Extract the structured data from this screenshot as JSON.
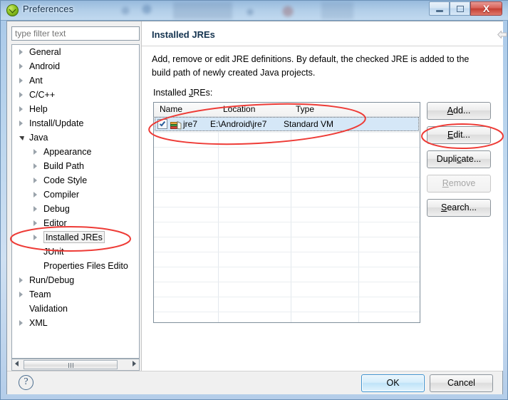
{
  "window": {
    "title": "Preferences",
    "icon": "eclipse-preferences-icon",
    "controls": {
      "minimize": "–",
      "maximize": "□",
      "close": "X"
    }
  },
  "sidebar": {
    "filter": {
      "placeholder": "type filter text",
      "value": ""
    },
    "items": [
      {
        "label": "General",
        "indent": 0,
        "state": "closed"
      },
      {
        "label": "Android",
        "indent": 0,
        "state": "closed"
      },
      {
        "label": "Ant",
        "indent": 0,
        "state": "closed"
      },
      {
        "label": "C/C++",
        "indent": 0,
        "state": "closed"
      },
      {
        "label": "Help",
        "indent": 0,
        "state": "closed"
      },
      {
        "label": "Install/Update",
        "indent": 0,
        "state": "closed"
      },
      {
        "label": "Java",
        "indent": 0,
        "state": "open"
      },
      {
        "label": "Appearance",
        "indent": 1,
        "state": "closed"
      },
      {
        "label": "Build Path",
        "indent": 1,
        "state": "closed"
      },
      {
        "label": "Code Style",
        "indent": 1,
        "state": "closed"
      },
      {
        "label": "Compiler",
        "indent": 1,
        "state": "closed"
      },
      {
        "label": "Debug",
        "indent": 1,
        "state": "closed"
      },
      {
        "label": "Editor",
        "indent": 1,
        "state": "closed"
      },
      {
        "label": "Installed JREs",
        "indent": 1,
        "state": "closed",
        "selected": true
      },
      {
        "label": "JUnit",
        "indent": 1,
        "state": "leaf"
      },
      {
        "label": "Properties Files Edito",
        "indent": 1,
        "state": "leaf"
      },
      {
        "label": "Run/Debug",
        "indent": 0,
        "state": "closed"
      },
      {
        "label": "Team",
        "indent": 0,
        "state": "closed"
      },
      {
        "label": "Validation",
        "indent": 0,
        "state": "leaf"
      },
      {
        "label": "XML",
        "indent": 0,
        "state": "closed"
      }
    ]
  },
  "content": {
    "title": "Installed JREs",
    "description": "Add, remove or edit JRE definitions. By default, the checked JRE is added to the build path of newly created Java projects.",
    "table_label_pre": "Installed ",
    "table_label_mnemonic": "J",
    "table_label_post": "REs:",
    "nav": {
      "back": "back-arrow",
      "back_menu": "back-dropdown",
      "forward": "forward-arrow",
      "forward_menu": "forward-dropdown",
      "view_menu": "view-menu-dropdown"
    },
    "table": {
      "columns": [
        "Name",
        "Location",
        "Type"
      ],
      "rows": [
        {
          "checked": true,
          "icon": "jre-library-icon",
          "name": "jre7",
          "location": "E:\\Android\\jre7",
          "type": "Standard VM"
        }
      ]
    },
    "buttons": [
      {
        "pre": "",
        "mn": "A",
        "post": "dd...",
        "enabled": true
      },
      {
        "pre": "",
        "mn": "E",
        "post": "dit...",
        "enabled": true
      },
      {
        "pre": "Dupli",
        "mn": "c",
        "post": "ate...",
        "enabled": true
      },
      {
        "pre": "",
        "mn": "R",
        "post": "emove",
        "enabled": false
      },
      {
        "pre": "",
        "mn": "S",
        "post": "earch...",
        "enabled": true
      }
    ]
  },
  "footer": {
    "help": "?",
    "ok": "OK",
    "cancel": "Cancel"
  },
  "annotations": {
    "color": "#ee3b36",
    "marks": [
      "ellipse-around-installed-jres-tree-item",
      "ellipse-around-jre-table-row",
      "ellipse-around-edit-button"
    ]
  },
  "colors": {
    "accent": "#3c93d0",
    "title_text": "#14334f",
    "selection": "#d5e7f7",
    "annotation_red": "#ee3b36"
  }
}
